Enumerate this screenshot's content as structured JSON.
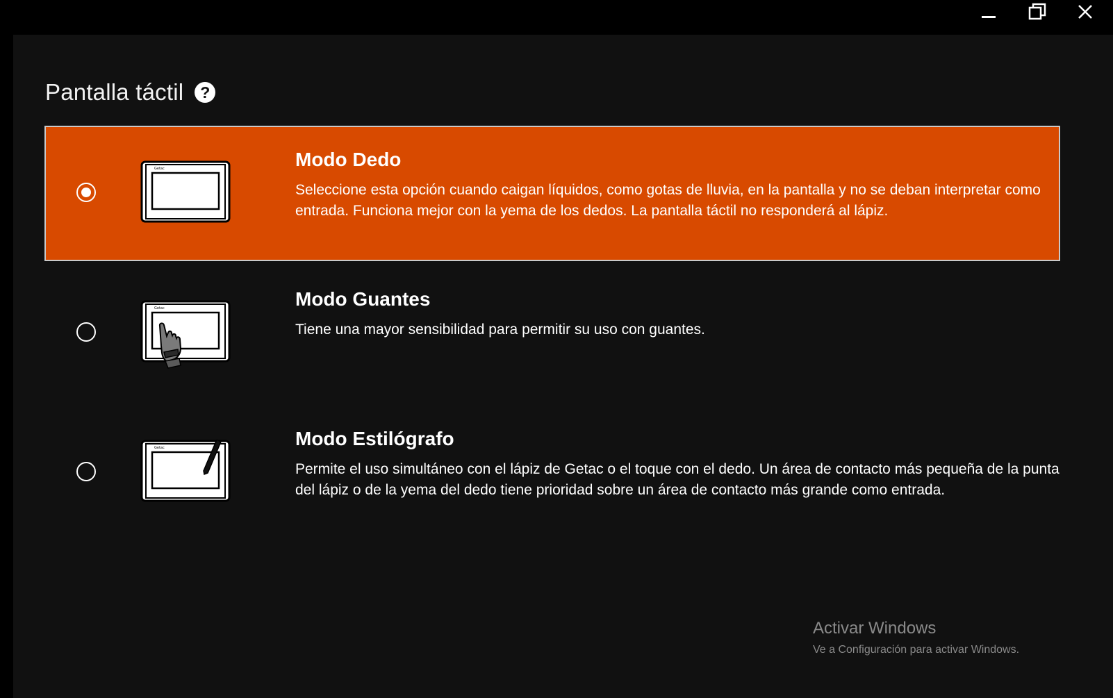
{
  "window": {
    "controls": {
      "minimize_icon": "minimize-icon",
      "restore_icon": "restore-icon",
      "close_icon": "close-icon"
    }
  },
  "page": {
    "title": "Pantalla táctil",
    "help_icon_glyph": "?"
  },
  "options": [
    {
      "title": "Modo Dedo",
      "description": "Seleccione esta opción cuando caigan líquidos, como gotas de lluvia, en la pantalla y no se deban interpretar como entrada. Funciona mejor con la yema de los dedos. La pantalla táctil no responderá al lápiz.",
      "selected": true,
      "icon": "tablet-icon"
    },
    {
      "title": "Modo Guantes",
      "description": "Tiene una mayor sensibilidad para permitir su uso con guantes.",
      "selected": false,
      "icon": "tablet-glove-icon"
    },
    {
      "title": "Modo Estilógrafo",
      "description": "Permite el uso simultáneo con el lápiz de Getac o el toque con el dedo. Un área de contacto más pequeña de la punta del lápiz o de la yema del dedo tiene prioridad sobre un área de contacto más grande como entrada.",
      "selected": false,
      "icon": "tablet-pen-icon"
    }
  ],
  "device_brand": "Getac",
  "watermark": {
    "title": "Activar Windows",
    "subtitle": "Ve a Configuración para activar Windows."
  },
  "colors": {
    "accent": "#d84a00",
    "background": "#111111",
    "titlebar": "#000000",
    "watermark": "#8a8a8a"
  }
}
